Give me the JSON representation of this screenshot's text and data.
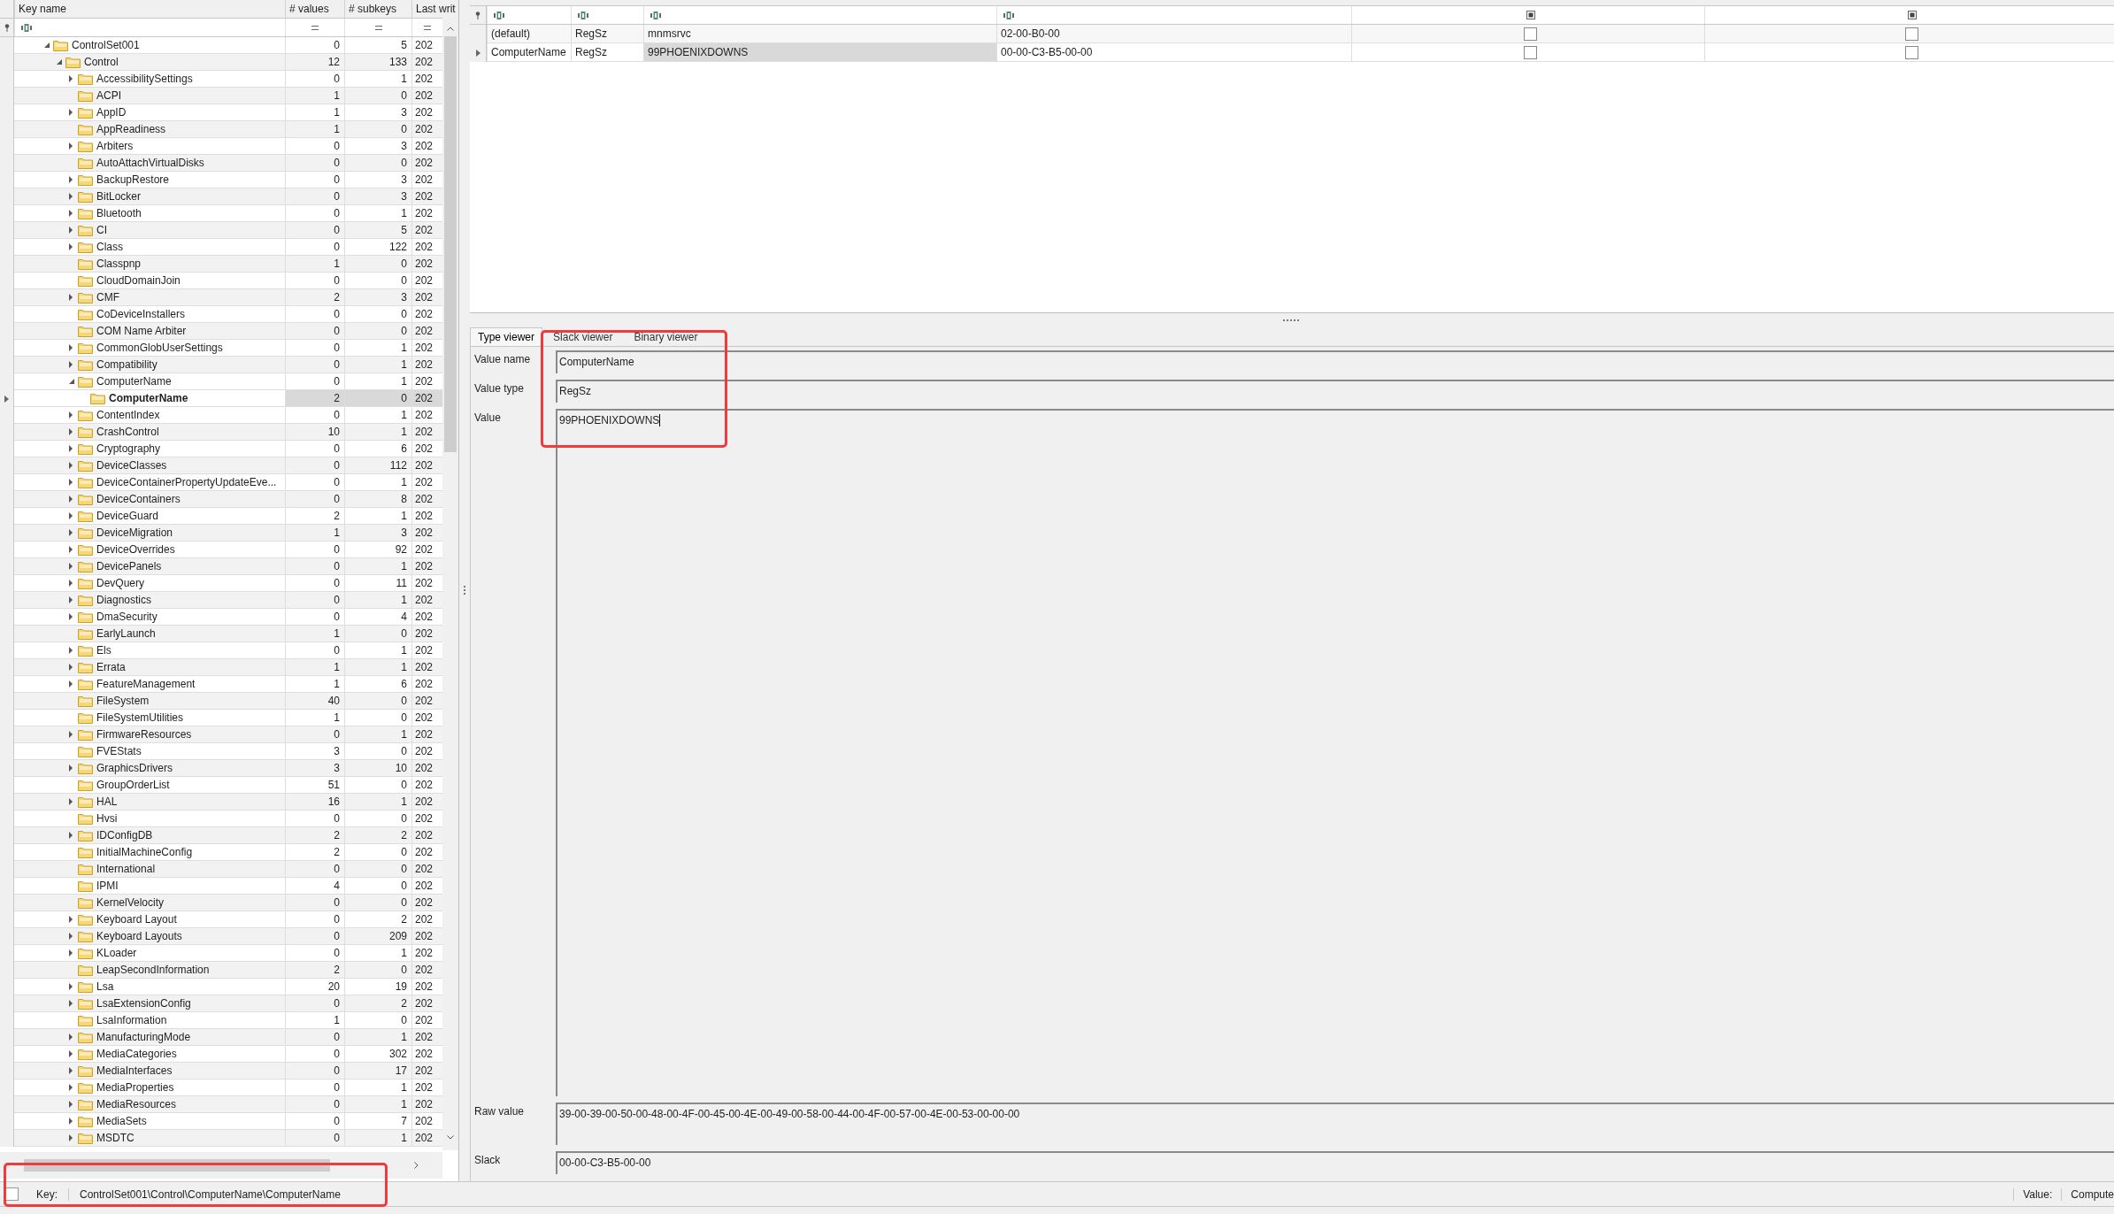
{
  "tree": {
    "columns": [
      "Key name",
      "# values",
      "# subkeys",
      "Last writ"
    ],
    "nodes": [
      {
        "name": "ControlSet001",
        "values": "0",
        "subkeys": "5",
        "last_write": "202",
        "expanded": true,
        "selected": false,
        "children": [
          {
            "name": "Control",
            "values": "12",
            "subkeys": "133",
            "last_write": "202",
            "expanded": true,
            "selected": false,
            "children": [
              {
                "name": "AccessibilitySettings",
                "values": "0",
                "subkeys": "1",
                "last_write": "202",
                "expanded": false,
                "selected": false
              },
              {
                "name": "ACPI",
                "values": "1",
                "subkeys": "0",
                "last_write": "202",
                "selected": false
              },
              {
                "name": "AppID",
                "values": "1",
                "subkeys": "3",
                "last_write": "202",
                "expanded": false,
                "selected": false
              },
              {
                "name": "AppReadiness",
                "values": "1",
                "subkeys": "0",
                "last_write": "202",
                "selected": false
              },
              {
                "name": "Arbiters",
                "values": "0",
                "subkeys": "3",
                "last_write": "202",
                "expanded": false,
                "selected": false
              },
              {
                "name": "AutoAttachVirtualDisks",
                "values": "0",
                "subkeys": "0",
                "last_write": "202",
                "selected": false
              },
              {
                "name": "BackupRestore",
                "values": "0",
                "subkeys": "3",
                "last_write": "202",
                "expanded": false,
                "selected": false
              },
              {
                "name": "BitLocker",
                "values": "0",
                "subkeys": "3",
                "last_write": "202",
                "expanded": false,
                "selected": false
              },
              {
                "name": "Bluetooth",
                "values": "0",
                "subkeys": "1",
                "last_write": "202",
                "expanded": false,
                "selected": false
              },
              {
                "name": "CI",
                "values": "0",
                "subkeys": "5",
                "last_write": "202",
                "expanded": false,
                "selected": false
              },
              {
                "name": "Class",
                "values": "0",
                "subkeys": "122",
                "last_write": "202",
                "expanded": false,
                "selected": false
              },
              {
                "name": "Classpnp",
                "values": "1",
                "subkeys": "0",
                "last_write": "202",
                "selected": false
              },
              {
                "name": "CloudDomainJoin",
                "values": "0",
                "subkeys": "0",
                "last_write": "202",
                "selected": false
              },
              {
                "name": "CMF",
                "values": "2",
                "subkeys": "3",
                "last_write": "202",
                "expanded": false,
                "selected": false
              },
              {
                "name": "CoDeviceInstallers",
                "values": "0",
                "subkeys": "0",
                "last_write": "202",
                "selected": false
              },
              {
                "name": "COM Name Arbiter",
                "values": "0",
                "subkeys": "0",
                "last_write": "202",
                "selected": false
              },
              {
                "name": "CommonGlobUserSettings",
                "values": "0",
                "subkeys": "1",
                "last_write": "202",
                "expanded": false,
                "selected": false
              },
              {
                "name": "Compatibility",
                "values": "0",
                "subkeys": "1",
                "last_write": "202",
                "expanded": false,
                "selected": false
              },
              {
                "name": "ComputerName",
                "values": "0",
                "subkeys": "1",
                "last_write": "202",
                "expanded": true,
                "selected": false,
                "children": [
                  {
                    "name": "ComputerName",
                    "values": "2",
                    "subkeys": "0",
                    "last_write": "202",
                    "selected": true
                  }
                ]
              },
              {
                "name": "ContentIndex",
                "values": "0",
                "subkeys": "1",
                "last_write": "202",
                "expanded": false,
                "selected": false
              },
              {
                "name": "CrashControl",
                "values": "10",
                "subkeys": "1",
                "last_write": "202",
                "expanded": false,
                "selected": false
              },
              {
                "name": "Cryptography",
                "values": "0",
                "subkeys": "6",
                "last_write": "202",
                "expanded": false,
                "selected": false
              },
              {
                "name": "DeviceClasses",
                "values": "0",
                "subkeys": "112",
                "last_write": "202",
                "expanded": false,
                "selected": false
              },
              {
                "name": "DeviceContainerPropertyUpdateEve...",
                "values": "0",
                "subkeys": "1",
                "last_write": "202",
                "expanded": false,
                "selected": false
              },
              {
                "name": "DeviceContainers",
                "values": "0",
                "subkeys": "8",
                "last_write": "202",
                "expanded": false,
                "selected": false
              },
              {
                "name": "DeviceGuard",
                "values": "2",
                "subkeys": "1",
                "last_write": "202",
                "expanded": false,
                "selected": false
              },
              {
                "name": "DeviceMigration",
                "values": "1",
                "subkeys": "3",
                "last_write": "202",
                "expanded": false,
                "selected": false
              },
              {
                "name": "DeviceOverrides",
                "values": "0",
                "subkeys": "92",
                "last_write": "202",
                "expanded": false,
                "selected": false
              },
              {
                "name": "DevicePanels",
                "values": "0",
                "subkeys": "1",
                "last_write": "202",
                "expanded": false,
                "selected": false
              },
              {
                "name": "DevQuery",
                "values": "0",
                "subkeys": "11",
                "last_write": "202",
                "expanded": false,
                "selected": false
              },
              {
                "name": "Diagnostics",
                "values": "0",
                "subkeys": "1",
                "last_write": "202",
                "expanded": false,
                "selected": false
              },
              {
                "name": "DmaSecurity",
                "values": "0",
                "subkeys": "4",
                "last_write": "202",
                "expanded": false,
                "selected": false
              },
              {
                "name": "EarlyLaunch",
                "values": "1",
                "subkeys": "0",
                "last_write": "202",
                "selected": false
              },
              {
                "name": "Els",
                "values": "0",
                "subkeys": "1",
                "last_write": "202",
                "expanded": false,
                "selected": false
              },
              {
                "name": "Errata",
                "values": "1",
                "subkeys": "1",
                "last_write": "202",
                "expanded": false,
                "selected": false
              },
              {
                "name": "FeatureManagement",
                "values": "1",
                "subkeys": "6",
                "last_write": "202",
                "expanded": false,
                "selected": false
              },
              {
                "name": "FileSystem",
                "values": "40",
                "subkeys": "0",
                "last_write": "202",
                "selected": false
              },
              {
                "name": "FileSystemUtilities",
                "values": "1",
                "subkeys": "0",
                "last_write": "202",
                "selected": false
              },
              {
                "name": "FirmwareResources",
                "values": "0",
                "subkeys": "1",
                "last_write": "202",
                "expanded": false,
                "selected": false
              },
              {
                "name": "FVEStats",
                "values": "3",
                "subkeys": "0",
                "last_write": "202",
                "selected": false
              },
              {
                "name": "GraphicsDrivers",
                "values": "3",
                "subkeys": "10",
                "last_write": "202",
                "expanded": false,
                "selected": false
              },
              {
                "name": "GroupOrderList",
                "values": "51",
                "subkeys": "0",
                "last_write": "202",
                "selected": false
              },
              {
                "name": "HAL",
                "values": "16",
                "subkeys": "1",
                "last_write": "202",
                "expanded": false,
                "selected": false
              },
              {
                "name": "Hvsi",
                "values": "0",
                "subkeys": "0",
                "last_write": "202",
                "selected": false
              },
              {
                "name": "IDConfigDB",
                "values": "2",
                "subkeys": "2",
                "last_write": "202",
                "expanded": false,
                "selected": false
              },
              {
                "name": "InitialMachineConfig",
                "values": "2",
                "subkeys": "0",
                "last_write": "202",
                "selected": false
              },
              {
                "name": "International",
                "values": "0",
                "subkeys": "0",
                "last_write": "202",
                "selected": false
              },
              {
                "name": "IPMI",
                "values": "4",
                "subkeys": "0",
                "last_write": "202",
                "selected": false
              },
              {
                "name": "KernelVelocity",
                "values": "0",
                "subkeys": "0",
                "last_write": "202",
                "selected": false
              },
              {
                "name": "Keyboard Layout",
                "values": "0",
                "subkeys": "2",
                "last_write": "202",
                "expanded": false,
                "selected": false
              },
              {
                "name": "Keyboard Layouts",
                "values": "0",
                "subkeys": "209",
                "last_write": "202",
                "expanded": false,
                "selected": false
              },
              {
                "name": "KLoader",
                "values": "0",
                "subkeys": "1",
                "last_write": "202",
                "expanded": false,
                "selected": false
              },
              {
                "name": "LeapSecondInformation",
                "values": "2",
                "subkeys": "0",
                "last_write": "202",
                "selected": false
              },
              {
                "name": "Lsa",
                "values": "20",
                "subkeys": "19",
                "last_write": "202",
                "expanded": false,
                "selected": false
              },
              {
                "name": "LsaExtensionConfig",
                "values": "0",
                "subkeys": "2",
                "last_write": "202",
                "expanded": false,
                "selected": false
              },
              {
                "name": "LsaInformation",
                "values": "1",
                "subkeys": "0",
                "last_write": "202",
                "selected": false
              },
              {
                "name": "ManufacturingMode",
                "values": "0",
                "subkeys": "1",
                "last_write": "202",
                "expanded": false,
                "selected": false
              },
              {
                "name": "MediaCategories",
                "values": "0",
                "subkeys": "302",
                "last_write": "202",
                "expanded": false,
                "selected": false
              },
              {
                "name": "MediaInterfaces",
                "values": "0",
                "subkeys": "17",
                "last_write": "202",
                "expanded": false,
                "selected": false
              },
              {
                "name": "MediaProperties",
                "values": "0",
                "subkeys": "1",
                "last_write": "202",
                "expanded": false,
                "selected": false
              },
              {
                "name": "MediaResources",
                "values": "0",
                "subkeys": "1",
                "last_write": "202",
                "expanded": false,
                "selected": false
              },
              {
                "name": "MediaSets",
                "values": "0",
                "subkeys": "7",
                "last_write": "202",
                "expanded": false,
                "selected": false
              },
              {
                "name": "MSDTC",
                "values": "0",
                "subkeys": "1",
                "last_write": "202",
                "expanded": false,
                "selected": false
              }
            ]
          }
        ]
      }
    ]
  },
  "values_table": {
    "rows": [
      {
        "value_name": "(default)",
        "value_type": "RegSz",
        "data": "mnmsrvc",
        "value_slack": "02-00-B0-00",
        "is_deleted": false,
        "reallocated": false,
        "selected": false
      },
      {
        "value_name": "ComputerName",
        "value_type": "RegSz",
        "data": "99PHOENIXDOWNS",
        "value_slack": "00-00-C3-B5-00-00",
        "is_deleted": false,
        "reallocated": false,
        "selected": true
      }
    ]
  },
  "viewer": {
    "tabs": [
      {
        "label": "Type viewer",
        "selected": true
      },
      {
        "label": "Slack viewer",
        "selected": false
      },
      {
        "label": "Binary viewer",
        "selected": false
      }
    ],
    "fields": [
      {
        "kind": "short",
        "label": "Value name",
        "value": "ComputerName"
      },
      {
        "kind": "short",
        "label": "Value type",
        "value": "RegSz"
      },
      {
        "kind": "tall",
        "label": "Value",
        "value": "99PHOENIXDOWNS"
      },
      {
        "kind": "medium",
        "label": "Raw value",
        "value": "39-00-39-00-50-00-48-00-4F-00-45-00-4E-00-49-00-58-00-44-00-4F-00-57-00-4E-00-53-00-00-00"
      },
      {
        "kind": "short",
        "label": "Slack",
        "value": "00-00-C3-B5-00-00"
      }
    ]
  },
  "status": {
    "checked": false,
    "key_label": "Key:",
    "key_path": "ControlSet001\\Control\\ComputerName\\ComputerName",
    "value_label": "Value:",
    "value_text": "Compute"
  }
}
